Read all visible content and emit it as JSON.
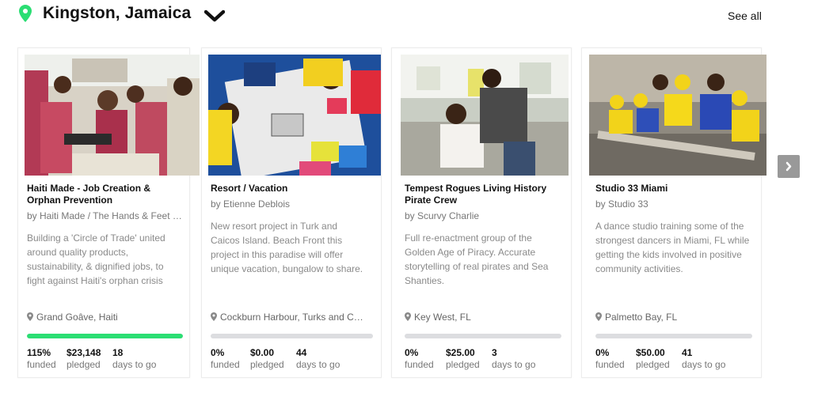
{
  "header": {
    "location": "Kingston, Jamaica",
    "see_all": "See all",
    "icons": {
      "pin": "location-pin-icon",
      "dropdown": "chevron-down-icon",
      "next": "chevron-right-icon"
    }
  },
  "colors": {
    "accent": "#2bde73",
    "progress_track": "#dcdde0",
    "nav_button": "#999999"
  },
  "cards": [
    {
      "title_line1": "Haiti Made - Job Creation &",
      "title_line2": "Orphan Prevention",
      "byline": "by Haiti Made / The Hands & Feet …",
      "blurb": [
        "Building a 'Circle of Trade' united",
        "around quality products,",
        "sustainability, & dignified jobs, to",
        "fight against Haiti's orphan crisis"
      ],
      "location": "Grand Goâve, Haiti",
      "progress": 1.0,
      "funded": "115%",
      "pledged": "$23,148",
      "days": "18",
      "funded_label": "funded",
      "pledged_label": "pledged",
      "days_label": "days to go"
    },
    {
      "title_line1": "Resort / Vacation",
      "title_line2": "",
      "byline": "by Etienne Deblois",
      "blurb": [
        "New resort project in Turk and",
        "Caicos Island. Beach Front this",
        "project in this paradise will offer",
        "unique vacation, bungalow to share."
      ],
      "location": "Cockburn Harbour, Turks and C…",
      "progress": 0.0,
      "funded": "0%",
      "pledged": "$0.00",
      "days": "44",
      "funded_label": "funded",
      "pledged_label": "pledged",
      "days_label": "days to go"
    },
    {
      "title_line1": "Tempest Rogues Living History",
      "title_line2": "Pirate Crew",
      "byline": "by Scurvy Charlie",
      "blurb": [
        "Full re-enactment group of the",
        "Golden Age of Piracy. Accurate",
        "storytelling of real pirates and Sea",
        "Shanties."
      ],
      "location": "Key West, FL",
      "progress": 0.0,
      "funded": "0%",
      "pledged": "$25.00",
      "days": "3",
      "funded_label": "funded",
      "pledged_label": "pledged",
      "days_label": "days to go"
    },
    {
      "title_line1": "Studio 33 Miami",
      "title_line2": "",
      "byline": "by Studio 33",
      "blurb": [
        "A dance studio training some of the",
        "strongest dancers in Miami, FL while",
        "getting the kids involved in positive",
        "community activities."
      ],
      "location": "Palmetto Bay, FL",
      "progress": 0.0,
      "funded": "0%",
      "pledged": "$50.00",
      "days": "41",
      "funded_label": "funded",
      "pledged_label": "pledged",
      "days_label": "days to go"
    }
  ]
}
